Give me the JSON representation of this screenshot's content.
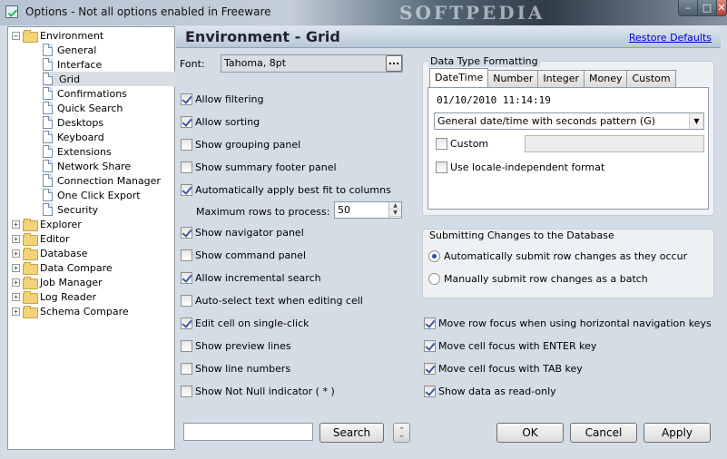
{
  "window": {
    "title": "Options - Not all options enabled in Freeware",
    "watermark": "SOFTPEDIA",
    "minimize": "–",
    "maximize": "□",
    "close": "✕"
  },
  "tree": {
    "environment": "Environment",
    "children": [
      "General",
      "Interface",
      "Grid",
      "Confirmations",
      "Quick Search",
      "Desktops",
      "Keyboard",
      "Extensions",
      "Network Share",
      "Connection Manager",
      "One Click Export",
      "Security"
    ],
    "selected": "Grid",
    "groups": [
      "Explorer",
      "Editor",
      "Database",
      "Data Compare",
      "Job Manager",
      "Log Reader",
      "Schema Compare"
    ]
  },
  "header": {
    "title": "Environment - Grid",
    "restore": "Restore Defaults"
  },
  "font": {
    "label": "Font:",
    "value": "Tahoma, 8pt",
    "button": "..."
  },
  "left_options": [
    {
      "label": "Allow filtering",
      "checked": true
    },
    {
      "label": "Allow sorting",
      "checked": true
    },
    {
      "label": "Show grouping panel",
      "checked": false
    },
    {
      "label": "Show summary footer panel",
      "checked": false
    },
    {
      "label": "Automatically apply best fit to columns",
      "checked": true
    }
  ],
  "maxrows": {
    "label": "Maximum rows to process:",
    "value": "50"
  },
  "left_options2": [
    {
      "label": "Show navigator panel",
      "checked": true
    },
    {
      "label": "Show command panel",
      "checked": false
    },
    {
      "label": "Allow incremental search",
      "checked": true
    },
    {
      "label": "Auto-select text when editing cell",
      "checked": false
    },
    {
      "label": "Edit cell on single-click",
      "checked": true
    },
    {
      "label": "Show preview lines",
      "checked": false
    },
    {
      "label": "Show line numbers",
      "checked": false
    },
    {
      "label": "Show Not Null indicator ( * )",
      "checked": false
    }
  ],
  "formatting": {
    "title": "Data Type Formatting",
    "tabs": [
      "DateTime",
      "Number",
      "Integer",
      "Money",
      "Custom"
    ],
    "active_tab": "DateTime",
    "preview": "01/10/2010 11:14:19",
    "pattern": "General date/time with seconds pattern (G)",
    "custom": {
      "label": "Custom",
      "checked": false
    },
    "locale": {
      "label": "Use locale-independent format",
      "checked": false
    }
  },
  "submitting": {
    "title": "Submitting Changes to the Database",
    "options": [
      {
        "label": "Automatically submit row changes as they occur",
        "selected": true
      },
      {
        "label": "Manually submit row changes as a batch",
        "selected": false
      }
    ]
  },
  "right_options": [
    {
      "label": "Move row focus when using horizontal navigation keys",
      "checked": true
    },
    {
      "label": "Move cell focus with ENTER key",
      "checked": true
    },
    {
      "label": "Move cell focus with TAB key",
      "checked": true
    },
    {
      "label": "Show data as read-only",
      "checked": true
    }
  ],
  "footer": {
    "search": "Search",
    "ok": "OK",
    "cancel": "Cancel",
    "apply": "Apply",
    "search_value": ""
  }
}
